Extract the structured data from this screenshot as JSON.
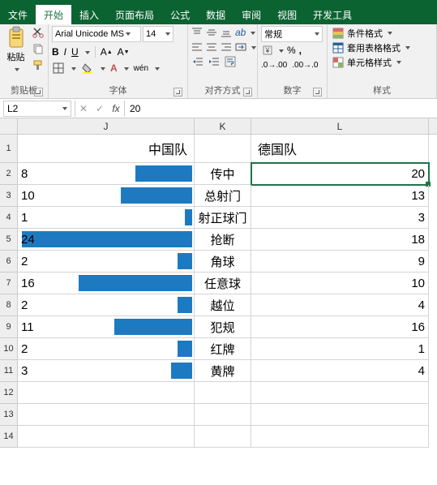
{
  "tabs": {
    "file": "文件",
    "home": "开始",
    "insert": "插入",
    "layout": "页面布局",
    "formulas": "公式",
    "data": "数据",
    "review": "审阅",
    "view": "视图",
    "dev": "开发工具"
  },
  "ribbon": {
    "clipboard": {
      "paste": "粘贴",
      "label": "剪贴板"
    },
    "font": {
      "name": "Arial Unicode MS",
      "size": "14",
      "label": "字体"
    },
    "align": {
      "label": "对齐方式"
    },
    "number": {
      "format": "常规",
      "label": "数字"
    },
    "styles": {
      "cond": "条件格式",
      "table": "套用表格格式",
      "cell": "单元格样式",
      "label": "样式"
    }
  },
  "namebox": {
    "ref": "L2"
  },
  "formula": "20",
  "headers": {
    "J": "J",
    "K": "K",
    "L": "L"
  },
  "teams": {
    "left": "中国队",
    "right": "德国队"
  },
  "rows": [
    {
      "label": "传中",
      "j": 8,
      "l": 20
    },
    {
      "label": "总射门",
      "j": 10,
      "l": 13
    },
    {
      "label": "射正球门",
      "j": 1,
      "l": 3
    },
    {
      "label": "抢断",
      "j": 24,
      "l": 18
    },
    {
      "label": "角球",
      "j": 2,
      "l": 9
    },
    {
      "label": "任意球",
      "j": 16,
      "l": 10
    },
    {
      "label": "越位",
      "j": 2,
      "l": 4
    },
    {
      "label": "犯规",
      "j": 11,
      "l": 16
    },
    {
      "label": "红牌",
      "j": 2,
      "l": 1
    },
    {
      "label": "黄牌",
      "j": 3,
      "l": 4
    }
  ],
  "chart_data": {
    "type": "bar",
    "note": "In-cell data bars in column J (left team). Bars are right-aligned; length proportional to value with max=24.",
    "max": 24,
    "categories": [
      "传中",
      "总射门",
      "射正球门",
      "抢断",
      "角球",
      "任意球",
      "越位",
      "犯规",
      "红牌",
      "黄牌"
    ],
    "series": [
      {
        "name": "中国队",
        "values": [
          8,
          10,
          1,
          24,
          2,
          16,
          2,
          11,
          2,
          3
        ]
      },
      {
        "name": "德国队",
        "values": [
          20,
          13,
          3,
          18,
          9,
          10,
          4,
          16,
          1,
          4
        ]
      }
    ]
  },
  "colors": {
    "bar": "#1e7ac0",
    "accent": "#217346"
  }
}
